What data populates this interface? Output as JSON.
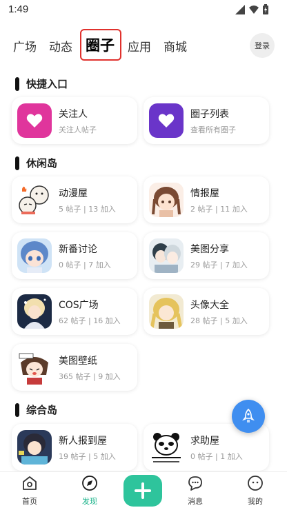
{
  "status": {
    "time": "1:49"
  },
  "nav": {
    "tabs": [
      {
        "label": "广场"
      },
      {
        "label": "动态"
      },
      {
        "label": "圈子"
      },
      {
        "label": "应用"
      },
      {
        "label": "商城"
      }
    ],
    "login": "登录"
  },
  "sections": {
    "quick": {
      "title": "快捷入口"
    },
    "leisure": {
      "title": "休闲岛"
    },
    "general": {
      "title": "综合岛"
    }
  },
  "quick_entries": [
    {
      "name": "关注人",
      "desc": "关注人帖子",
      "color": "#e0359c",
      "icon": "heart-icon"
    },
    {
      "name": "圈子列表",
      "desc": "查看所有圈子",
      "color": "#6a35c9",
      "icon": "heart-icon"
    }
  ],
  "leisure_circles": [
    {
      "name": "动漫屋",
      "meta": "5 帖子 | 13 加入"
    },
    {
      "name": "情报屋",
      "meta": "2 帖子 | 11 加入"
    },
    {
      "name": "新番讨论",
      "meta": "0 帖子 | 7 加入"
    },
    {
      "name": "美图分享",
      "meta": "29 帖子 | 7 加入"
    },
    {
      "name": "COS广场",
      "meta": "62 帖子 | 16 加入"
    },
    {
      "name": "头像大全",
      "meta": "28 帖子 | 5 加入"
    },
    {
      "name": "美图壁纸",
      "meta": "365 帖子 | 9 加入"
    }
  ],
  "general_circles": [
    {
      "name": "新人报到屋",
      "meta": "19 帖子 | 5 加入"
    },
    {
      "name": "求助屋",
      "meta": "0 帖子 | 1 加入"
    }
  ],
  "bottom_nav": [
    {
      "label": "首页",
      "icon": "home-icon"
    },
    {
      "label": "发现",
      "icon": "compass-icon"
    },
    {
      "label": "",
      "icon": "plus-icon"
    },
    {
      "label": "消息",
      "icon": "message-icon"
    },
    {
      "label": "我的",
      "icon": "profile-icon"
    }
  ],
  "colors": {
    "accent": "#2ec49c",
    "highlight": "#e0312d",
    "fab": "#3f8ef0"
  }
}
